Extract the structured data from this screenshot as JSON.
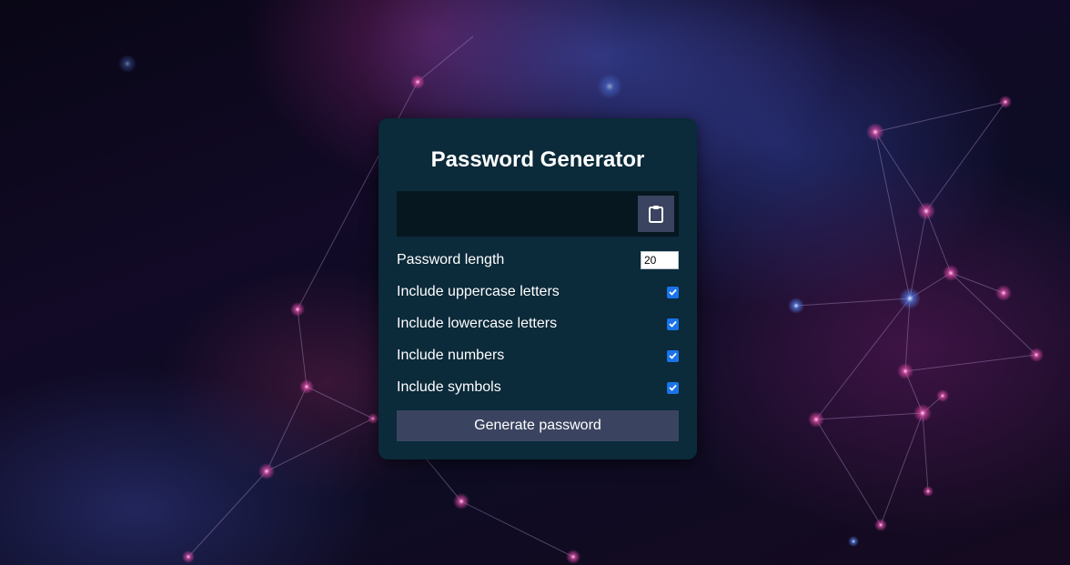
{
  "app": {
    "title": "Password Generator"
  },
  "result": {
    "value": "",
    "copy_icon": "clipboard-icon"
  },
  "settings": {
    "length": {
      "label": "Password length",
      "value": "20"
    },
    "options": [
      {
        "label": "Include uppercase letters",
        "checked": true
      },
      {
        "label": "Include lowercase letters",
        "checked": true
      },
      {
        "label": "Include numbers",
        "checked": true
      },
      {
        "label": "Include symbols",
        "checked": true
      }
    ]
  },
  "actions": {
    "generate_label": "Generate password"
  },
  "colors": {
    "card_background": "#0b2a3a",
    "result_background": "#06171f",
    "button_background": "#3a4460",
    "checkbox_accent": "#1a73e8"
  }
}
